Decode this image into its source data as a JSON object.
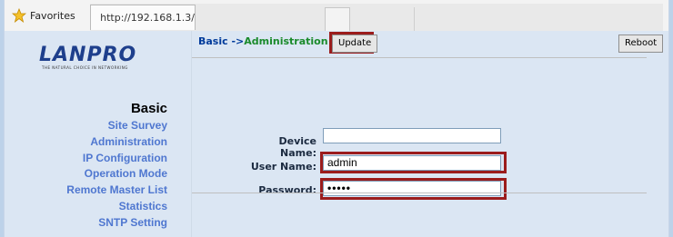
{
  "browser": {
    "favorites_label": "Favorites",
    "tab_url": "http://192.168.1.3/"
  },
  "brand": {
    "logo_text": "LANPRO",
    "tagline": "THE NATURAL CHOICE IN NETWORKING"
  },
  "sidebar": {
    "section_title": "Basic",
    "items": [
      {
        "label": "Site Survey"
      },
      {
        "label": "Administration"
      },
      {
        "label": "IP Configuration"
      },
      {
        "label": "Operation Mode"
      },
      {
        "label": "Remote Master List"
      },
      {
        "label": "Statistics"
      },
      {
        "label": "SNTP Setting"
      }
    ]
  },
  "page": {
    "breadcrumb_prefix": "Basic ->",
    "breadcrumb_current": "Administration",
    "update_label": "Update",
    "reboot_label": "Reboot"
  },
  "form": {
    "device_name_label": "Device Name:",
    "device_name_value": "",
    "user_name_label": "User Name:",
    "user_name_value": "admin",
    "password_label": "Password:",
    "password_value": "•••••"
  },
  "colors": {
    "highlight_border": "#9b1c1c",
    "nav_link": "#4f77d0",
    "breadcrumb_current": "#1a8a2b"
  }
}
